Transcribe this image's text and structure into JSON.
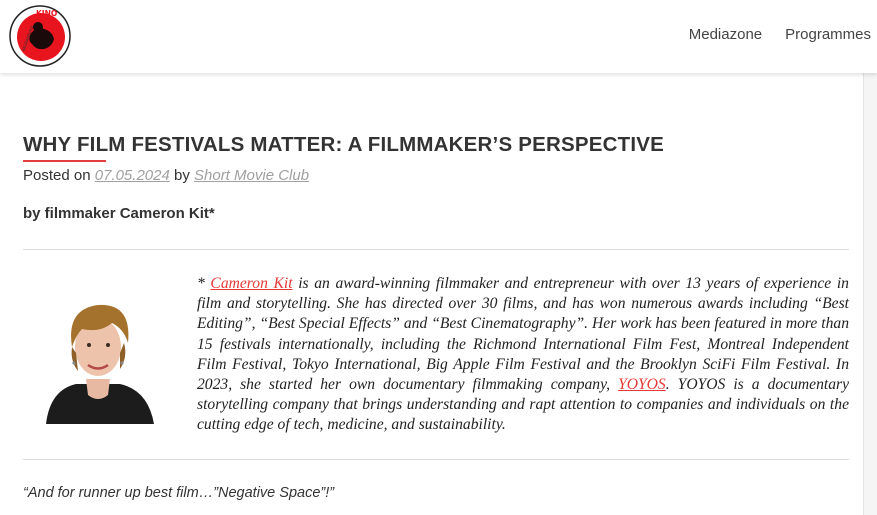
{
  "header": {
    "logo_text": "KINO",
    "logo_ring_text": "VAGRAMNAYA",
    "nav": [
      "Mediazone",
      "Programmes"
    ]
  },
  "post": {
    "title": "WHY FILM FESTIVALS MATTER: A FILMMAKER’S PERSPECTIVE",
    "meta_posted_on": "Posted on",
    "meta_date": "07.05.2024",
    "meta_by": "by",
    "meta_author": "Short Movie Club",
    "byline": "by filmmaker Cameron Kit*",
    "bio": {
      "star": "* ",
      "name": "Cameron Kit",
      "part1": " is an award-winning filmmaker and entrepreneur with over 13 years of experience in film and storytelling. She has directed over 30 films, and has won numerous awards including “Best Editing”, “Best Special Effects” and “Best Cinematography”. Her work has been featured in more than 15 festivals internationally, including the Richmond International Film Fest, Montreal Independent Film Festival, Tokyo International, Big Apple Film Festival and the Brooklyn SciFi Film Festival. In 2023, she started her own documentary filmmaking company, ",
      "company": "YOYOS",
      "part2": ". YOYOS is a documentary storytelling company that brings understanding and rapt attention to companies and individuals on the cutting edge of tech, medicine, and sustainability."
    },
    "quote": "“And for runner up best film…”Negative Space”!”"
  },
  "colors": {
    "accent": "#e63e3e",
    "link_muted": "#a0a0a0",
    "logo_red": "#e8141e"
  }
}
